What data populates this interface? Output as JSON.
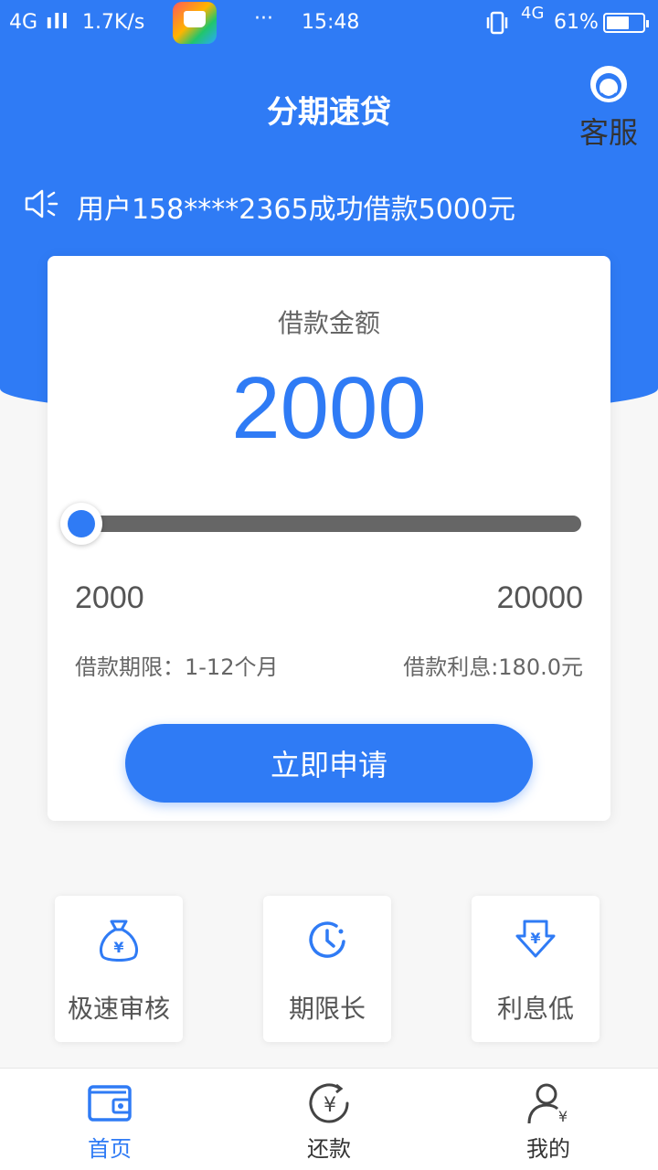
{
  "status_bar": {
    "network": "4G",
    "signal": "ıll",
    "speed": "1.7K/s",
    "more": "···",
    "time": "15:48",
    "net2": "4G",
    "battery": "61%"
  },
  "header": {
    "title": "分期速贷",
    "service_label": "客服"
  },
  "notice": {
    "text": "用户158****2365成功借款5000元"
  },
  "loan": {
    "label": "借款金额",
    "amount": "2000",
    "slider_min": "2000",
    "slider_max": "20000",
    "slider_fraction": 0.0,
    "term": "借款期限：1-12个月",
    "interest": "借款利息:180.0元",
    "apply_label": "立即申请"
  },
  "features": [
    {
      "label": "极速审核",
      "icon": "money-bag-icon"
    },
    {
      "label": "期限长",
      "icon": "clock-icon"
    },
    {
      "label": "利息低",
      "icon": "yuan-down-arrow-icon"
    }
  ],
  "tabbar": [
    {
      "label": "首页",
      "icon": "wallet-icon",
      "active": true
    },
    {
      "label": "还款",
      "icon": "yuan-circle-icon",
      "active": false
    },
    {
      "label": "我的",
      "icon": "user-icon",
      "active": false
    }
  ],
  "colors": {
    "primary": "#2f7bf5",
    "track": "#666666",
    "background": "#f7f7f7"
  }
}
